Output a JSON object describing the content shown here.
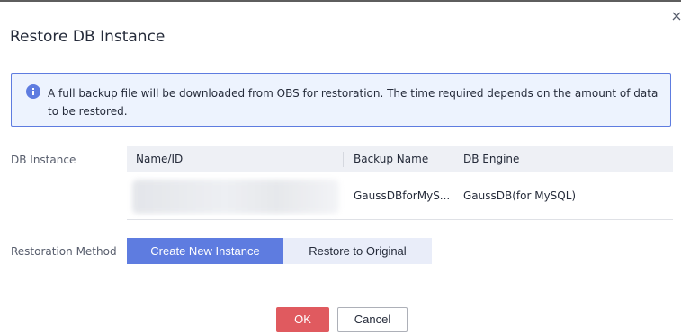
{
  "dialog": {
    "title": "Restore DB Instance"
  },
  "info": {
    "text": "A full backup file will be downloaded from OBS for restoration. The time required depends on the amount of data to be restored."
  },
  "instance": {
    "label": "DB Instance",
    "columns": [
      "Name/ID",
      "Backup Name",
      "DB Engine"
    ],
    "rows": [
      {
        "name_id": "",
        "backup_name": "GaussDBforMyS...",
        "db_engine": "GaussDB(for MySQL)"
      }
    ]
  },
  "restoration": {
    "label": "Restoration Method",
    "options": [
      "Create New Instance",
      "Restore to Original"
    ],
    "selected": "Create New Instance"
  },
  "footer": {
    "ok_label": "OK",
    "cancel_label": "Cancel"
  },
  "icons": {
    "close": "close-icon",
    "info": "info-icon"
  },
  "colors": {
    "accent": "#5e7ce0",
    "info_bg": "#edf3fe",
    "ok_button": "#e05a5f"
  }
}
